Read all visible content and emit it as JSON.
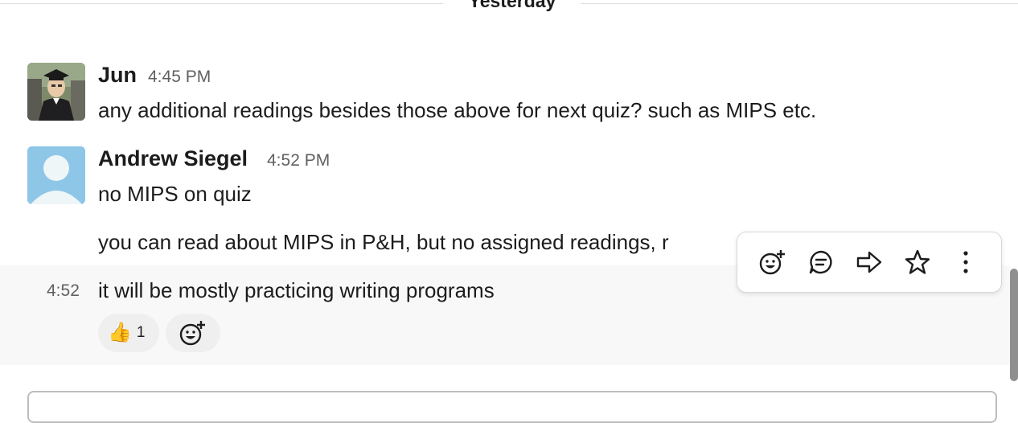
{
  "divider": {
    "label": "Yesterday"
  },
  "messages": [
    {
      "author": "Jun",
      "time": "4:45 PM",
      "lines": [
        "any additional readings besides those above for next quiz? such as MIPS etc."
      ]
    },
    {
      "author": "Andrew Siegel",
      "time": "4:52 PM",
      "lines": [
        "no MIPS on quiz",
        "you can read about MIPS in P&H, but no assigned readings, r"
      ]
    }
  ],
  "followup": {
    "gutter_time": "4:52",
    "text": "it will be mostly practicing writing programs",
    "reactions": [
      {
        "emoji": "👍",
        "count": "1"
      }
    ]
  },
  "toolbar_actions": [
    "add-reaction",
    "reply-in-thread",
    "share-message",
    "save-message",
    "more-actions"
  ],
  "colors": {
    "text": "#1d1c1d",
    "muted": "#616061",
    "avatar_default": "#8ec6e8",
    "hover_row": "#f8f8f8",
    "reaction_bg": "#efefef"
  }
}
